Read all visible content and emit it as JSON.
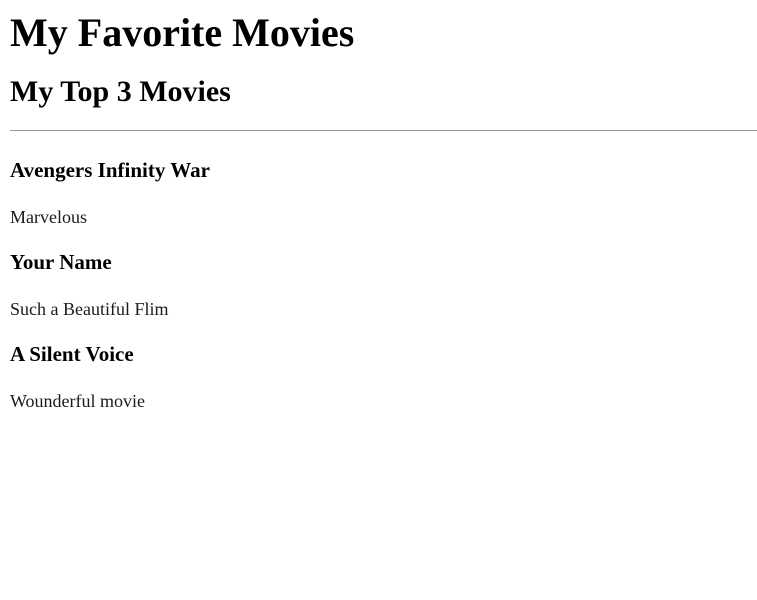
{
  "page": {
    "title": "My Favorite Movies",
    "subtitle": "My Top 3 Movies"
  },
  "movies": [
    {
      "title": "Avengers Infinity War",
      "review": "Marvelous"
    },
    {
      "title": "Your Name",
      "review": "Such a Beautiful Flim"
    },
    {
      "title": "A Silent Voice",
      "review": "Wounderful movie"
    }
  ]
}
